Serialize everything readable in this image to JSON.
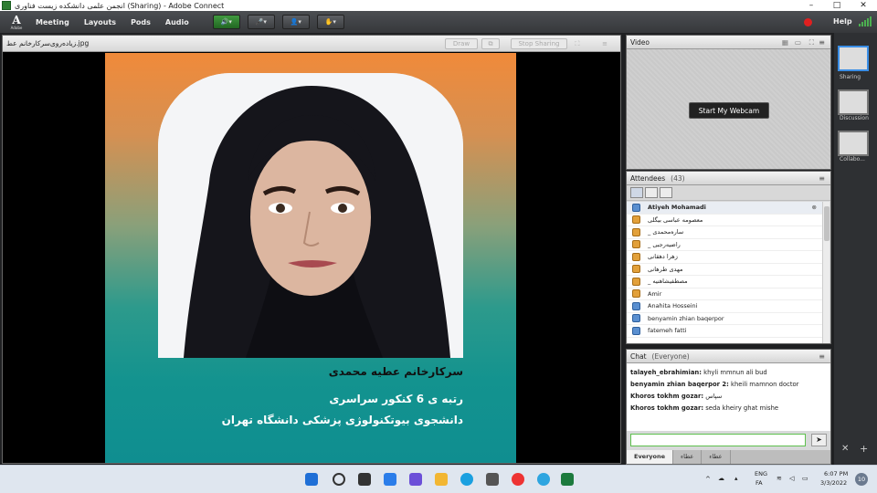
{
  "window": {
    "title": "انجمن علمی دانشکده زیست فناوری (Sharing) - Adobe Connect"
  },
  "menubar": {
    "logo_text": "Adobe",
    "items": [
      "Meeting",
      "Layouts",
      "Pods",
      "Audio"
    ],
    "help_label": "Help"
  },
  "share_pod": {
    "title": "زیاده‌روی‌سرکارخانم عط.jpg",
    "draw_label": "Draw",
    "stop_sharing_label": "Stop Sharing",
    "slide": {
      "name": "سرکارخانم عطیه محمدی",
      "line1": "رتبه ی 6 کنکور سراسری",
      "line2": "دانشجوی بیوتکنولوژی پزشکی دانشگاه تهران"
    }
  },
  "video_pod": {
    "title": "Video",
    "webcam_button": "Start My Webcam"
  },
  "attendees_pod": {
    "title": "Attendees",
    "count": "(43)",
    "host": "Atiyeh Mohamadi",
    "attendees": [
      "معصومه عباسی بیگلی",
      "_ ساره‌محمدی",
      "_ راضیه‌رجبی",
      "زهرا دهقانی",
      "مهدی طرهانی",
      "_ مصطفیشاهنیه",
      "Amir",
      "Anahita Hosseini",
      "benyamin zhian baqerpor",
      "fatemeh fatti"
    ]
  },
  "chat_pod": {
    "title": "Chat",
    "scope": "(Everyone)",
    "messages": [
      {
        "sender": "talayeh_ebrahimian:",
        "text": "khyli mmnun   ali bud"
      },
      {
        "sender": "benyamin zhian baqerpor 2:",
        "text": "kheili mamnon doctor"
      },
      {
        "sender": "Khoros tokhm gozar:",
        "text": "سپاس"
      },
      {
        "sender": "Khoros tokhm gozar:",
        "text": "seda kheiry ghat mishe"
      }
    ],
    "tabs": [
      "Everyone",
      "عطاء",
      "عطاء"
    ]
  },
  "layouts": {
    "items": [
      "Sharing",
      "Discussion",
      "Collabo..."
    ]
  },
  "taskbar": {
    "lang_top": "ENG",
    "lang_bottom": "FA",
    "time": "6:07 PM",
    "date": "3/3/2022",
    "notification_count": "10"
  }
}
